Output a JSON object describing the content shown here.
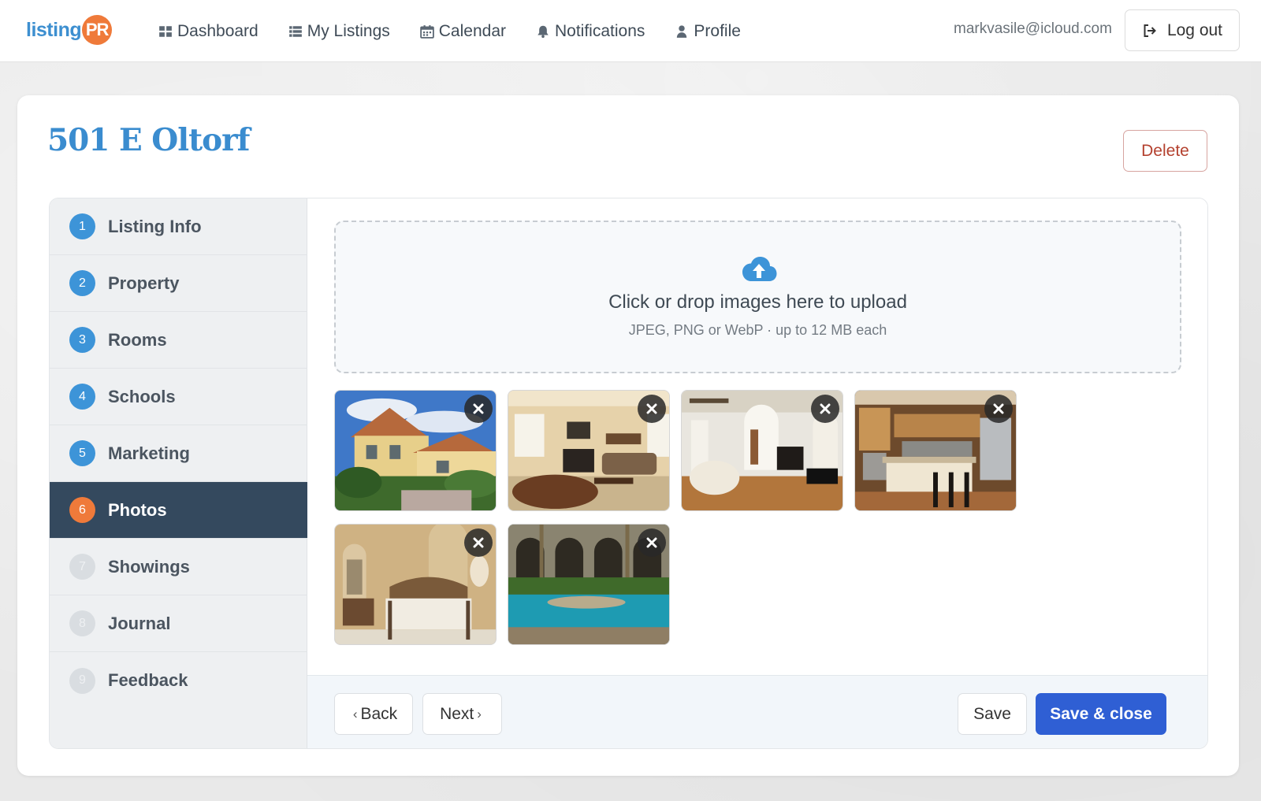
{
  "brand": {
    "logo_text": "listing",
    "logo_badge": "PR"
  },
  "nav": {
    "items": [
      {
        "label": "Dashboard",
        "icon": "dashboard-icon"
      },
      {
        "label": "My Listings",
        "icon": "list-icon"
      },
      {
        "label": "Calendar",
        "icon": "calendar-icon"
      },
      {
        "label": "Notifications",
        "icon": "bell-icon"
      },
      {
        "label": "Profile",
        "icon": "user-icon"
      }
    ],
    "user_email": "markvasile@icloud.com",
    "logout_label": "Log out"
  },
  "page": {
    "title": "501 E Oltorf",
    "delete_label": "Delete"
  },
  "steps": [
    {
      "num": "1",
      "label": "Listing Info",
      "state": "done"
    },
    {
      "num": "2",
      "label": "Property",
      "state": "done"
    },
    {
      "num": "3",
      "label": "Rooms",
      "state": "done"
    },
    {
      "num": "4",
      "label": "Schools",
      "state": "done"
    },
    {
      "num": "5",
      "label": "Marketing",
      "state": "done"
    },
    {
      "num": "6",
      "label": "Photos",
      "state": "active"
    },
    {
      "num": "7",
      "label": "Showings",
      "state": "future"
    },
    {
      "num": "8",
      "label": "Journal",
      "state": "future"
    },
    {
      "num": "9",
      "label": "Feedback",
      "state": "future"
    }
  ],
  "upload": {
    "title": "Click or drop images here to upload",
    "subtitle": "JPEG, PNG or WebP · up to 12 MB each",
    "icon": "cloud-upload-icon"
  },
  "photos": [
    {
      "name": "photo-exterior"
    },
    {
      "name": "photo-living-room"
    },
    {
      "name": "photo-great-room"
    },
    {
      "name": "photo-kitchen"
    },
    {
      "name": "photo-bedroom"
    },
    {
      "name": "photo-pool"
    }
  ],
  "footer": {
    "back_label": "Back",
    "next_label": "Next",
    "save_label": "Save",
    "save_close_label": "Save & close"
  },
  "colors": {
    "accent_blue": "#3a8ccf",
    "active_step_bg": "#34495e",
    "active_step_badge": "#ef7a3a",
    "primary_button": "#2f5fd4",
    "delete_text": "#b4412f"
  }
}
